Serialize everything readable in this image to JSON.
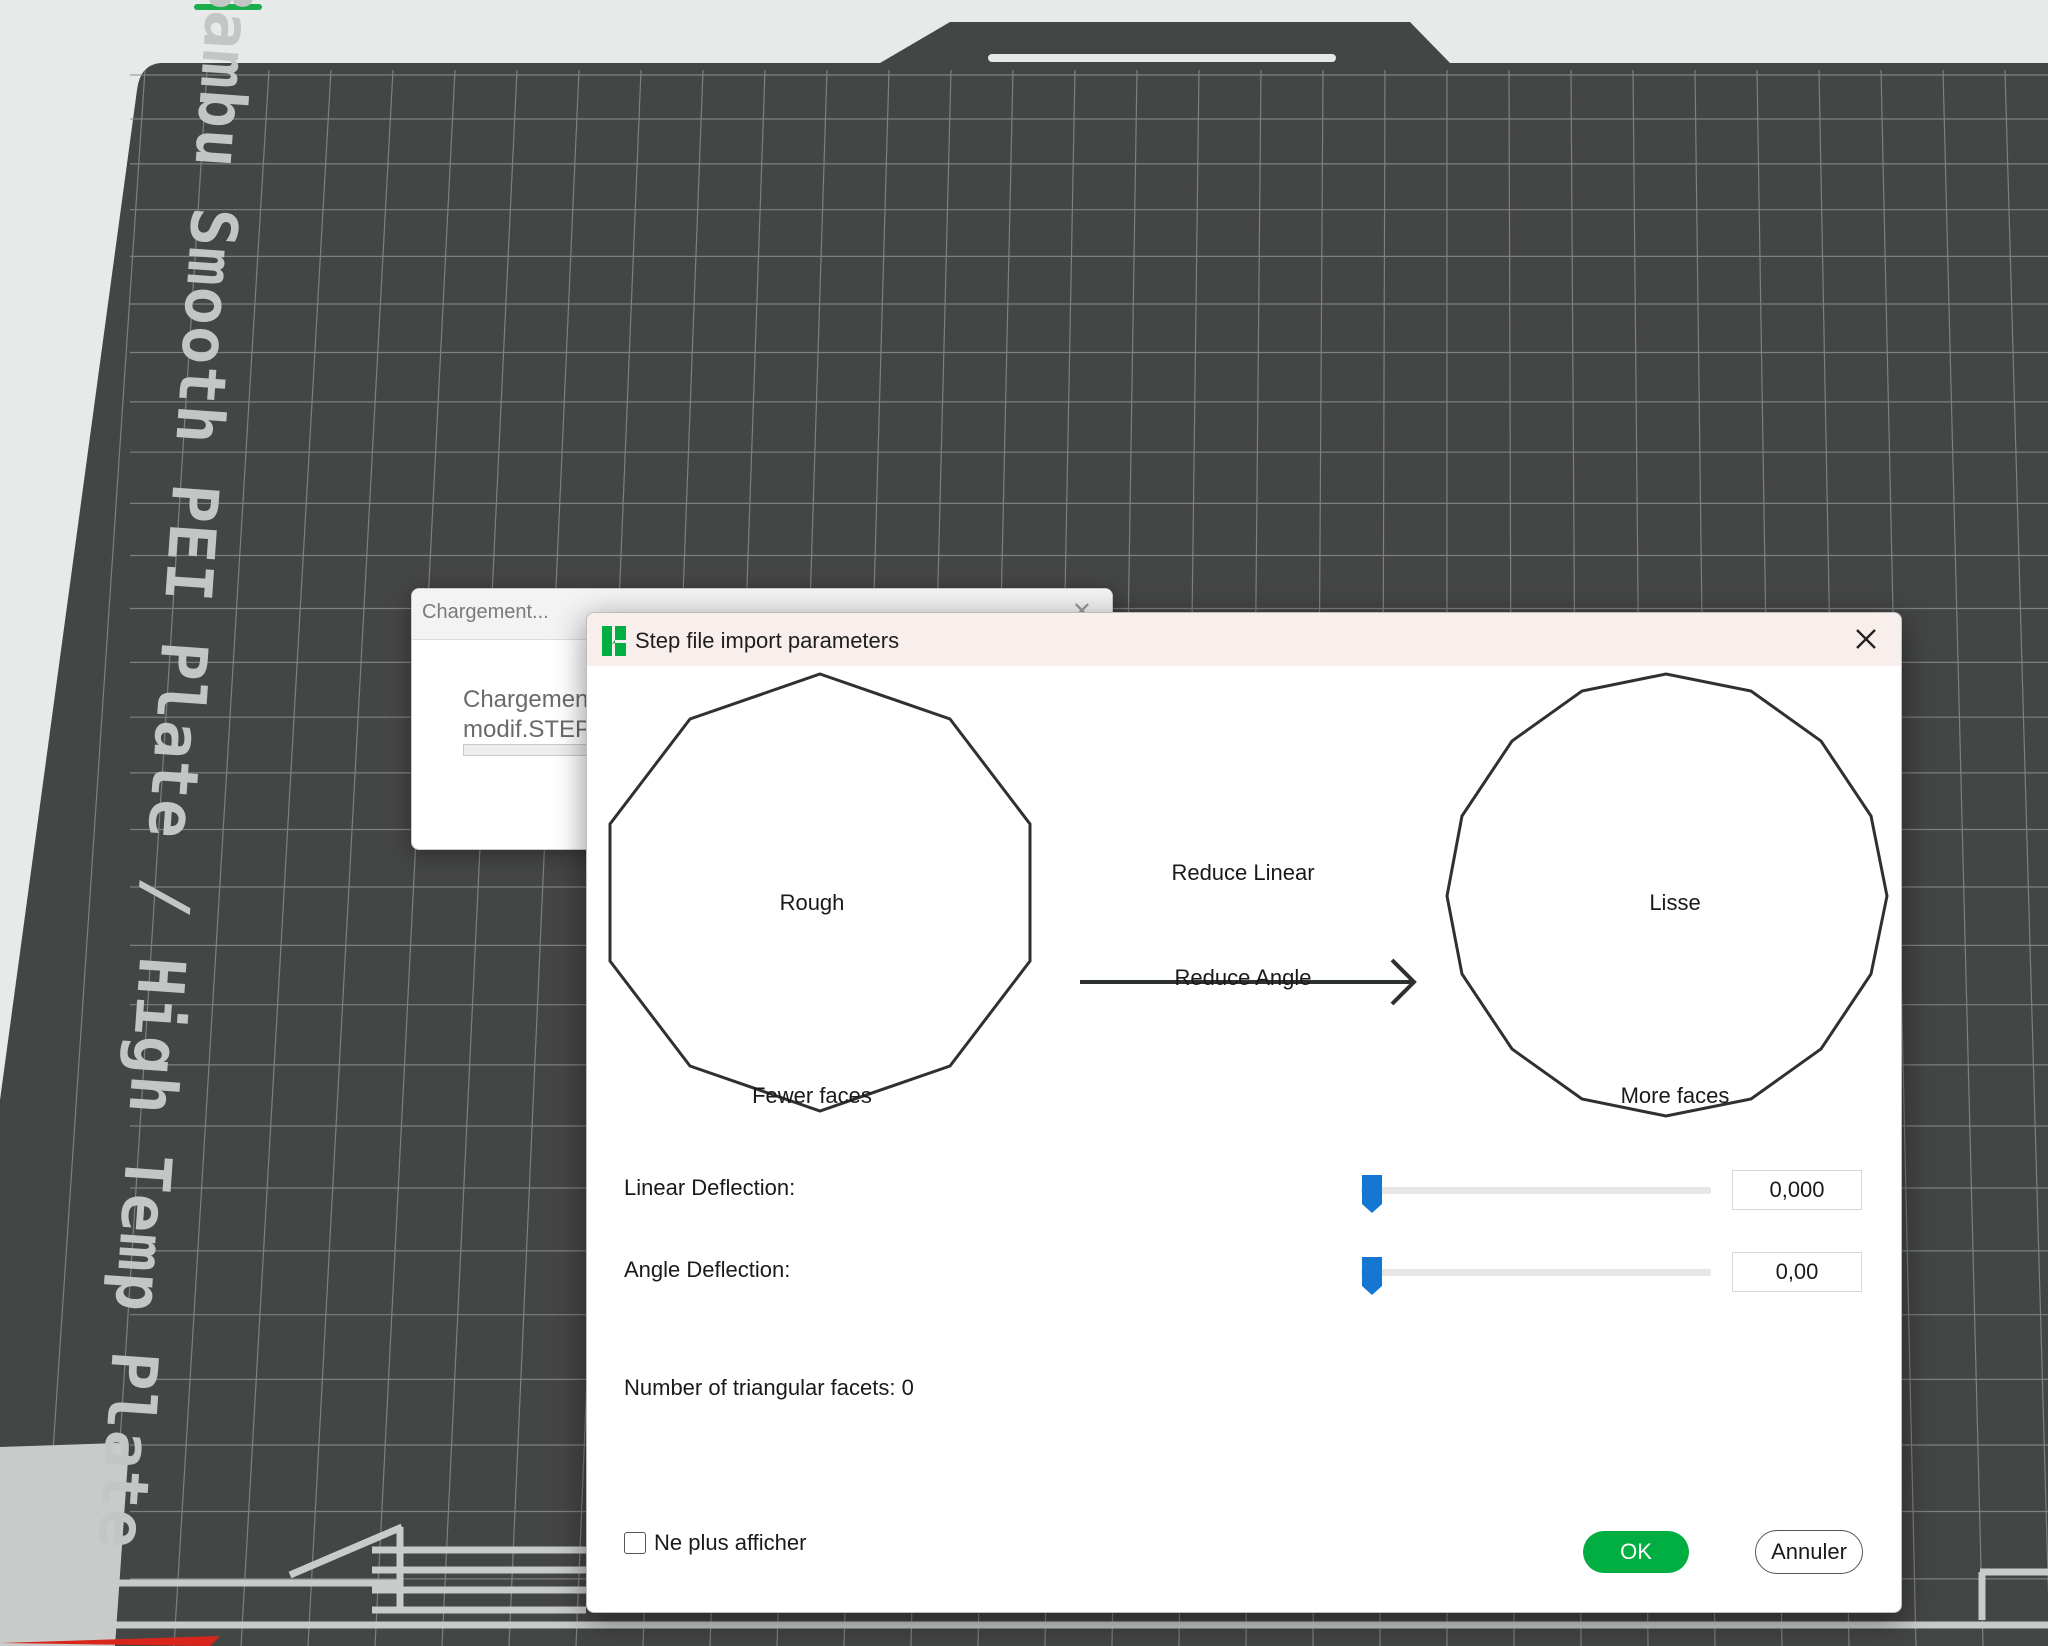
{
  "plate": {
    "label": "Bambu Smooth PEI Plate / High Temp Plate",
    "bed_color": "#444545",
    "grid_color": "#8d8f8f",
    "accent": "#1cae4d"
  },
  "loading_window": {
    "title": "Chargement...",
    "close_icon": "close-icon",
    "message_line1": "Chargement",
    "message_line2": "modif.STEP"
  },
  "dialog": {
    "title": "Step file import parameters",
    "app_icon": "bambu-studio-logo-icon",
    "close_icon": "close-icon",
    "diagram": {
      "left_shape_label": "Rough",
      "left_shape_caption": "Fewer faces",
      "arrow_label_top": "Reduce Linear",
      "arrow_label_bottom": "Reduce Angle",
      "right_shape_label": "Lisse",
      "right_shape_caption": "More faces"
    },
    "linear_deflection": {
      "label": "Linear Deflection:",
      "value": "0,000",
      "slider_position": 0.03
    },
    "angle_deflection": {
      "label": "Angle Deflection:",
      "value": "0,00",
      "slider_position": 0.03
    },
    "facets_text": "Number of triangular facets: 0",
    "dont_show_again": {
      "label": "Ne plus afficher",
      "checked": false
    },
    "ok_label": "OK",
    "cancel_label": "Annuler",
    "ok_color": "#00ae42",
    "slider_color": "#1677d2"
  }
}
